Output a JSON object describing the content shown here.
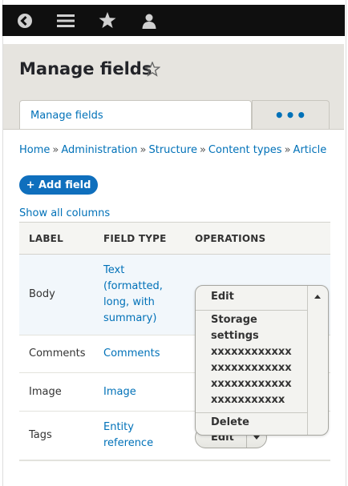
{
  "toolbar": {
    "icons": [
      "back-icon",
      "menu-icon",
      "star-icon",
      "user-icon"
    ]
  },
  "header": {
    "title": "Manage fields",
    "tabs": [
      {
        "label": "Manage fields",
        "active": true
      },
      {
        "label": "•••",
        "active": false
      }
    ]
  },
  "breadcrumb": {
    "items": [
      "Home",
      "Administration",
      "Structure",
      "Content types",
      "Article"
    ],
    "separator": "»"
  },
  "actions": {
    "add_field": "+ Add field",
    "show_all_columns": "Show all columns"
  },
  "table": {
    "headers": [
      "LABEL",
      "FIELD TYPE",
      "OPERATIONS"
    ],
    "rows": [
      {
        "label": "Body",
        "type_lines": [
          "Text",
          "(formatted,",
          "long, with",
          "summary)"
        ]
      },
      {
        "label": "Comments",
        "type_lines": [
          "Comments"
        ]
      },
      {
        "label": "Image",
        "type_lines": [
          "Image"
        ]
      },
      {
        "label": "Tags",
        "type_lines": [
          "Entity",
          "reference"
        ]
      }
    ]
  },
  "operations": {
    "edit": "Edit",
    "dropdown_items": [
      "Storage",
      "settings",
      "xxxxxxxxxxxx",
      "xxxxxxxxxxxx",
      "xxxxxxxxxxxx",
      "xxxxxxxxxxx"
    ],
    "delete": "Delete"
  },
  "colors": {
    "toolbar_bg": "#0f0f0f",
    "header_bg": "#e6e4df",
    "link": "#0071b8",
    "primary_button": "#0f6fbd"
  }
}
